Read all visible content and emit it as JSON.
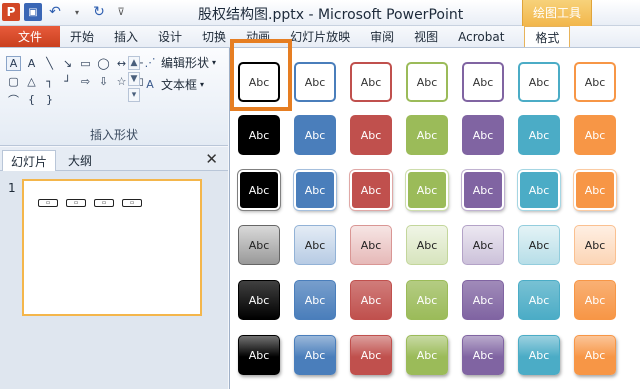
{
  "titlebar": {
    "app_icon": "P",
    "title": "股权结构图.pptx - Microsoft PowerPoint",
    "context_tab": "绘图工具"
  },
  "tabs": [
    {
      "label": "文件"
    },
    {
      "label": "开始"
    },
    {
      "label": "插入"
    },
    {
      "label": "设计"
    },
    {
      "label": "切换"
    },
    {
      "label": "动画"
    },
    {
      "label": "幻灯片放映"
    },
    {
      "label": "审阅"
    },
    {
      "label": "视图"
    },
    {
      "label": "Acrobat"
    },
    {
      "label": "格式"
    }
  ],
  "ribbon": {
    "edit_shape": "编辑形状",
    "text_box": "文本框",
    "group_label": "插入形状"
  },
  "pane": {
    "tab_slides": "幻灯片",
    "tab_outline": "大纲",
    "slide_number": "1"
  },
  "gallery": {
    "tile_label": "Abc",
    "colors": [
      "#000000",
      "#4a7ebb",
      "#c0504d",
      "#9bbb59",
      "#8064a2",
      "#4bacc6",
      "#f79646"
    ]
  }
}
